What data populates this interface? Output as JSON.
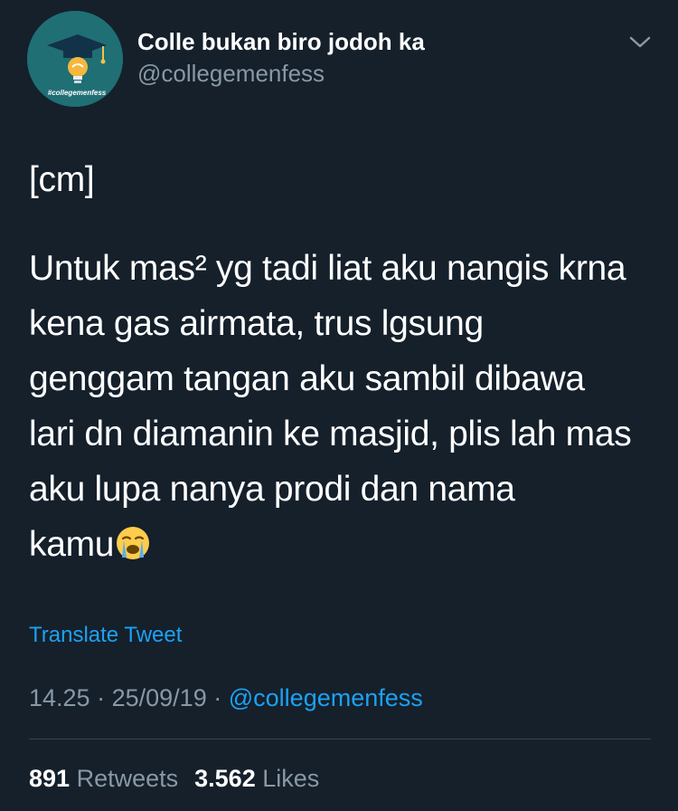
{
  "tweet": {
    "display_name": "Colle bukan biro jodoh ka",
    "handle": "@collegemenfess",
    "avatar_text": "#collegemenfess",
    "body_tag": "[cm]",
    "body_lines": [
      "Untuk mas² yg tadi liat aku nangis krna",
      "kena gas airmata, trus lgsung",
      "genggam tangan aku sambil dibawa",
      "lari dn diamanin ke masjid, plis lah mas",
      "aku lupa nanya prodi dan nama",
      "kamu"
    ],
    "emoji": "loudly-crying-face-emoji",
    "translate_label": "Translate Tweet",
    "time": "14.25",
    "date": "25/09/19",
    "separator": "·",
    "via_handle": "@collegemenfess",
    "retweets_count": "891",
    "retweets_label": "Retweets",
    "likes_count": "3.562",
    "likes_label": "Likes"
  },
  "colors": {
    "background": "#15202b",
    "text_primary": "#ffffff",
    "text_secondary": "#8899a6",
    "link": "#1da1f2",
    "divider": "#38444d",
    "avatar_bg": "#1f6f74"
  },
  "icons": {
    "menu": "chevron-down-icon",
    "avatar_logo": "graduation-cap-lightbulb-icon"
  }
}
